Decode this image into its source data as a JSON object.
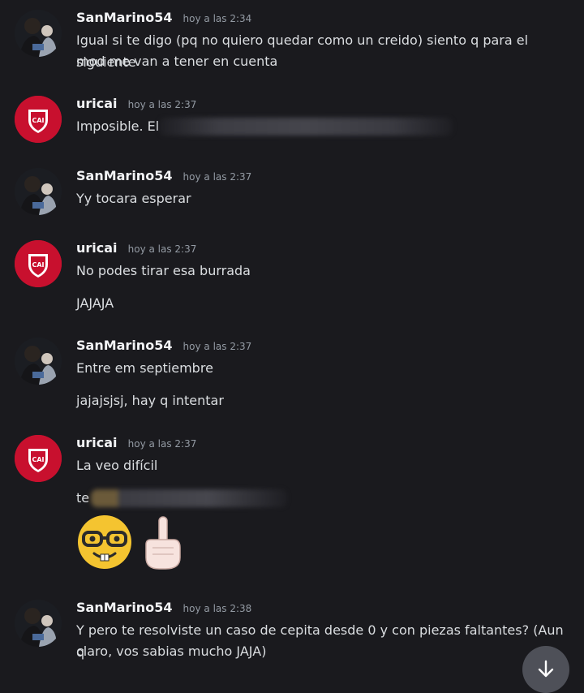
{
  "users": {
    "san": "SanMarino54",
    "uri": "uricai"
  },
  "messages": [
    {
      "author": "SanMarino54",
      "time": "hoy a las 2:34",
      "lines": [
        "Igual si te digo (pq no quiero quedar como un creido) siento q para el siguiente",
        "mod me van a tener en cuenta"
      ]
    },
    {
      "author": "uricai",
      "time": "hoy a las 2:37",
      "lines": [
        "Imposible.  El"
      ]
    },
    {
      "author": "SanMarino54",
      "time": "hoy a las 2:37",
      "lines": [
        "Yy tocara esperar"
      ]
    },
    {
      "author": "uricai",
      "time": "hoy a las 2:37",
      "lines": [
        "No podes tirar esa burrada",
        "JAJAJA"
      ]
    },
    {
      "author": "SanMarino54",
      "time": "hoy a las 2:37",
      "lines": [
        "Entre em septiembre",
        "jajajsjsj, hay q intentar"
      ]
    },
    {
      "author": "uricai",
      "time": "hoy a las 2:37",
      "lines": [
        "La veo difícil",
        "te"
      ]
    },
    {
      "author": "SanMarino54",
      "time": "hoy a las 2:38",
      "lines": [
        "Y pero te resolviste un caso de cepita desde 0 y con piezas faltantes? (Aun q",
        "claro, vos sabias mucho JAJA)"
      ]
    }
  ],
  "emojis": [
    "nerd-face",
    "index-pointing-up"
  ],
  "icons": {
    "jump": "arrow-down-icon"
  },
  "colors": {
    "background": "#1a1a1e",
    "username": "#f2f3f5",
    "timestamp": "#949ba4",
    "text": "#dbdee1",
    "uricai_avatar": "#c8102e"
  }
}
